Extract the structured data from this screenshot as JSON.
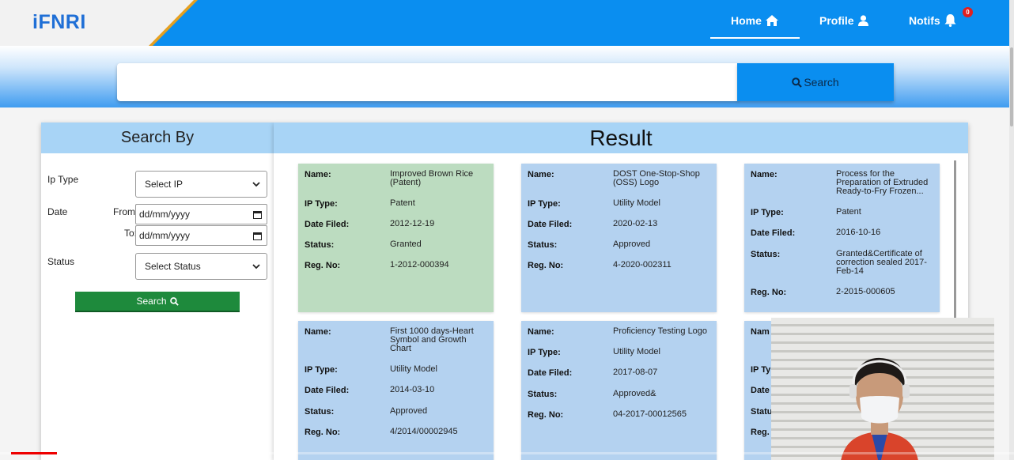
{
  "header": {
    "logo": "iFNRI",
    "nav": {
      "home": "Home",
      "profile": "Profile",
      "notifs": "Notifs",
      "notif_count": "0"
    }
  },
  "search": {
    "value": "",
    "button_label": "Search"
  },
  "side_panel": {
    "title": "Search By",
    "ip_type_label": "Ip Type",
    "ip_type_value": "Select IP",
    "date_label": "Date",
    "from_label": "From:",
    "to_label": "To:",
    "date_placeholder": "dd/mm/yyyy",
    "status_label": "Status",
    "status_value": "Select Status",
    "search_button": "Search"
  },
  "results": {
    "title": "Result",
    "field_labels": {
      "name": "Name:",
      "ip_type": "IP Type:",
      "date_filed": "Date Filed:",
      "status": "Status:",
      "reg_no": "Reg. No:"
    },
    "cards": [
      {
        "name": "Improved Brown Rice (Patent)",
        "ip_type": "Patent",
        "date_filed": "2012-12-19",
        "status": "Granted",
        "reg_no": "1-2012-000394",
        "color": "#bcdcc0"
      },
      {
        "name": "DOST One-Stop-Shop (OSS) Logo",
        "ip_type": "Utility Model",
        "date_filed": "2020-02-13",
        "status": "Approved",
        "reg_no": "4-2020-002311",
        "color": "#b4d2f0"
      },
      {
        "name": "Process for the Preparation of Extruded Ready-to-Fry Frozen...",
        "ip_type": "Patent",
        "date_filed": "2016-10-16",
        "status": "Granted&Certificate of correction sealed 2017-Feb-14",
        "reg_no": "2-2015-000605",
        "color": "#b4d2f0"
      },
      {
        "name": "First 1000 days-Heart Symbol and Growth Chart",
        "ip_type": "Utility Model",
        "date_filed": "2014-03-10",
        "status": "Approved",
        "reg_no": "4/2014/00002945",
        "color": "#b4d2f0"
      },
      {
        "name": "Proficiency Testing Logo",
        "ip_type": "Utility Model",
        "date_filed": "2017-08-07",
        "status": "Approved&",
        "reg_no": "04-2017-00012565",
        "color": "#b4d2f0"
      },
      {
        "name_label_partial": "Nam",
        "ip_label_partial": "IP Ty",
        "date_label_partial": "Date",
        "status_label_partial": "Statu",
        "reg_label_partial": "Reg.",
        "color": "#b4d2f0"
      }
    ]
  },
  "video": {
    "progress": 0.045
  }
}
